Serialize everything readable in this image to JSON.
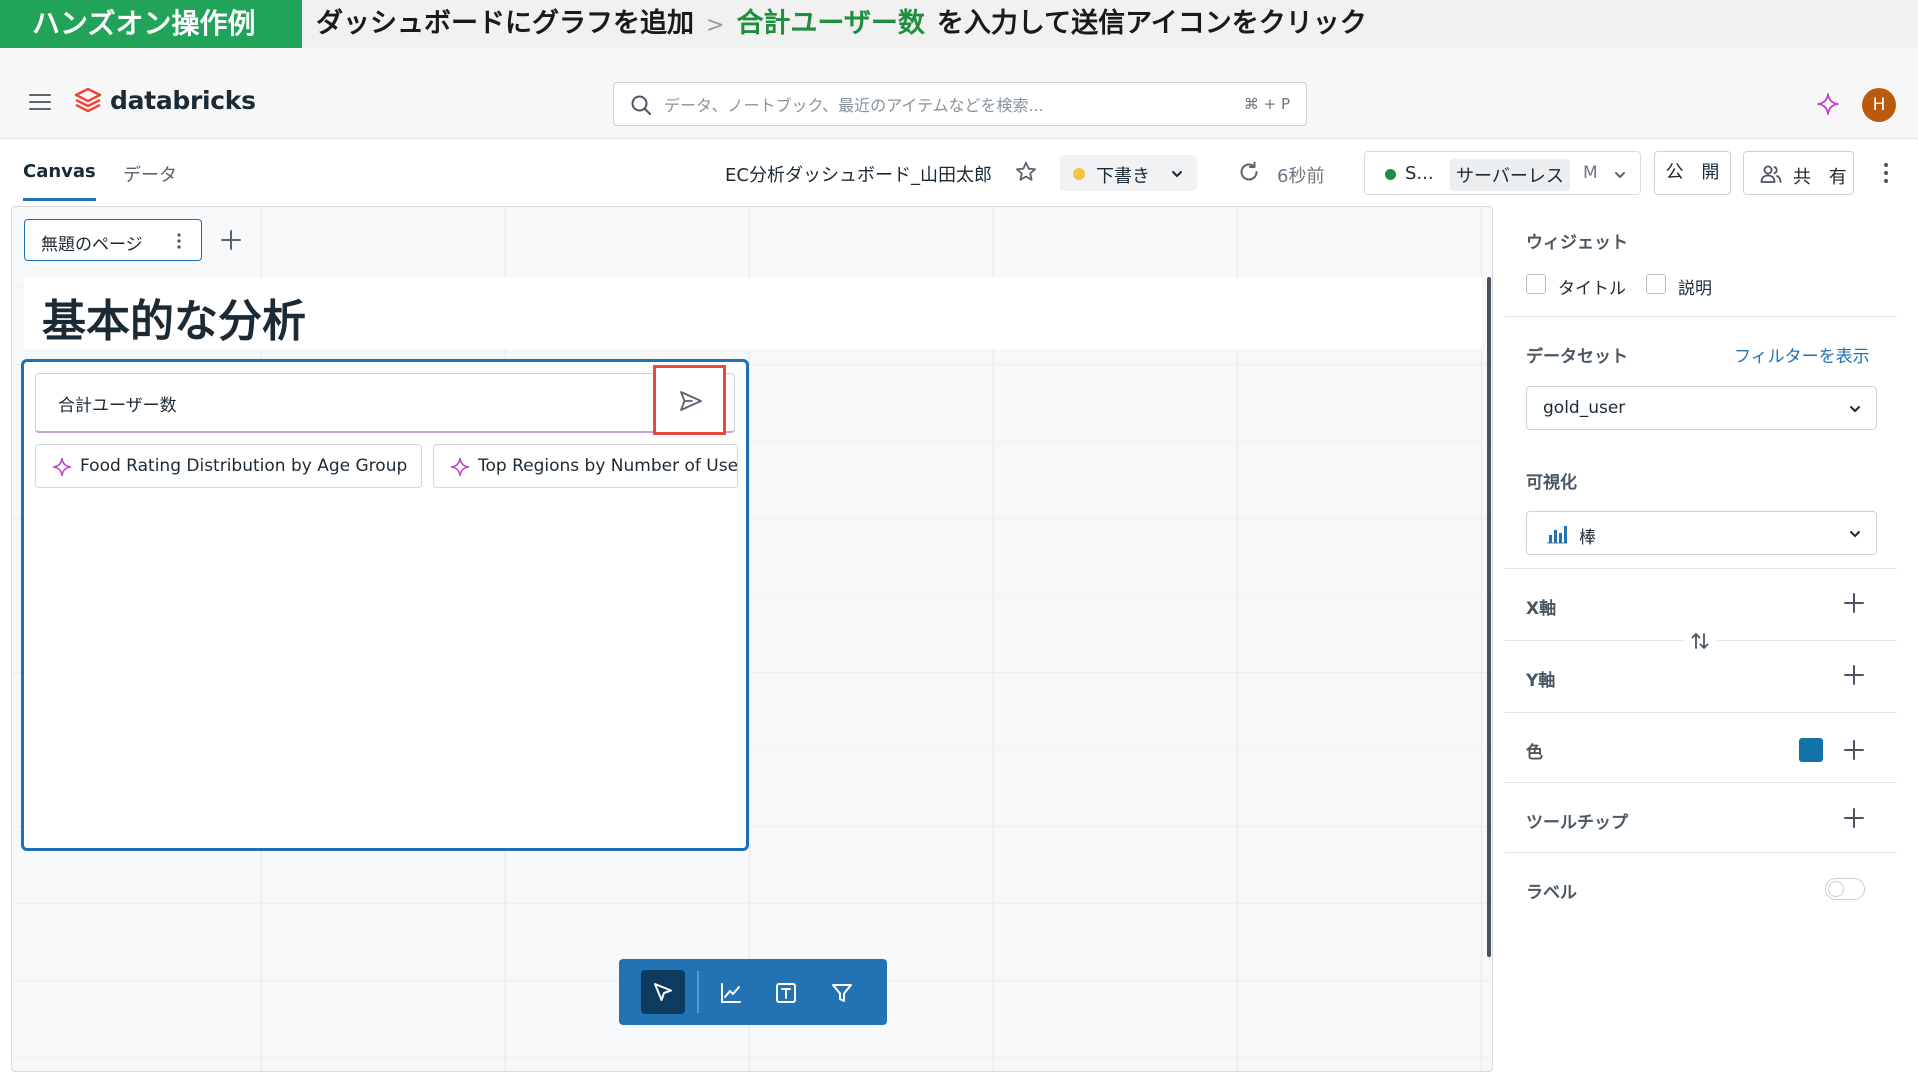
{
  "banner": {
    "badge": "ハンズオン操作例",
    "step": "ダッシュボードにグラフを追加",
    "separator": ">",
    "highlight": "合計ユーザー数",
    "instruction": "を入力して送信アイコンをクリック"
  },
  "topnav": {
    "brand": "databricks",
    "search_placeholder": "データ、ノートブック、最近のアイテムなどを検索...",
    "search_shortcut": "⌘ + P",
    "avatar_initial": "H"
  },
  "toolbar": {
    "tabs": [
      {
        "label": "Canvas",
        "active": true
      },
      {
        "label": "データ",
        "active": false
      }
    ],
    "dashboard_title": "EC分析ダッシュボード_山田太郎",
    "draft_label": "下書き",
    "refreshed": "6秒前",
    "compute": {
      "name": "S...",
      "type": "サーバーレス",
      "size": "M"
    },
    "publish_label": "公 開",
    "share_label": "共 有"
  },
  "canvas": {
    "page_tab": "無題のページ",
    "heading": "基本的な分析",
    "widget": {
      "prompt_value": "合計ユーザー数",
      "suggestions": [
        "Food Rating Distribution by Age Group",
        "Top Regions by Number of Users"
      ]
    }
  },
  "panel": {
    "widget_section": "ウィジェット",
    "title_checkbox": "タイトル",
    "description_checkbox": "説明",
    "dataset_section": "データセット",
    "filter_link": "フィルターを表示",
    "dataset_value": "gold_user",
    "viz_section": "可視化",
    "viz_value": "棒",
    "x_axis": "X軸",
    "y_axis": "Y軸",
    "color": "色",
    "color_value": "#1273a8",
    "tooltip": "ツールチップ",
    "label": "ラベル",
    "label_toggle_on": false
  },
  "colors": {
    "accent": "#2272b4",
    "banner_green": "#21a35a",
    "highlight_green": "#1f8f3f",
    "send_highlight": "#e8493f"
  }
}
